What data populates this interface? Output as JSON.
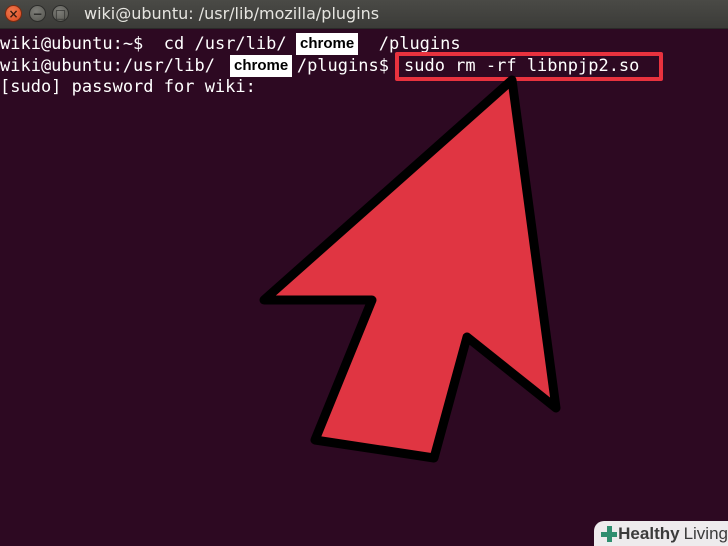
{
  "window": {
    "title": "wiki@ubuntu: /usr/lib/mozilla/plugins",
    "close_glyph": "×",
    "minimize_glyph": "−",
    "maximize_glyph": "□"
  },
  "terminal": {
    "line1_prompt": "wiki@ubuntu:~$",
    "line1_command_a": "cd /usr/lib/",
    "line1_command_b": "/plugins",
    "line2_prompt_a": "wiki@ubuntu:/usr/lib/",
    "line2_prompt_b": "/plugins$",
    "line2_command": "sudo rm -rf libnpjp2.so",
    "line3": "[sudo] password for wiki:",
    "overlay_label": "chrome"
  },
  "annotation": {
    "highlight_color": "#e8323e",
    "arrow_color": "#e03542"
  },
  "watermark": {
    "icon": "medical-cross-icon",
    "brand_bold": "Healthy",
    "brand_light": "Living"
  },
  "colors": {
    "terminal_bg": "#2d0922",
    "titlebar": "#3f3f3c"
  }
}
